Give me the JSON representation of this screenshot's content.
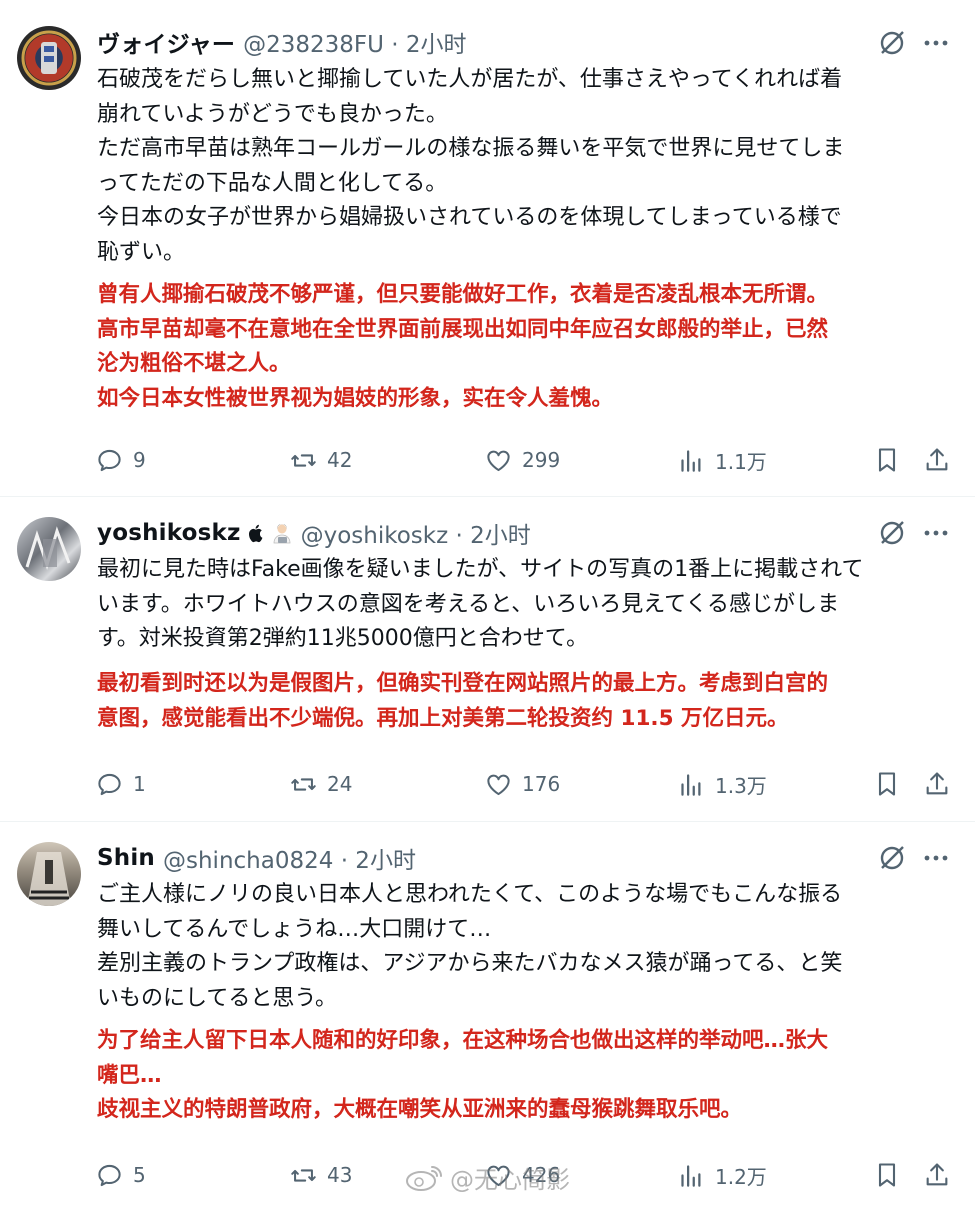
{
  "posts": [
    {
      "name": "ヴォイジャー",
      "handle": "@238238FU · 2小时",
      "ja": [
        "石破茂をだらし無いと揶揄していた人が居たが、仕事さえやってくれれば着\n崩れていようがどうでも良かった。",
        "ただ高市早苗は熟年コールガールの様な振る舞いを平気で世界に見せてしま\nってただの下品な人間と化してる。",
        "今日本の女子が世界から娼婦扱いされているのを体現してしまっている様で\n恥ずい。"
      ],
      "cn": [
        "曾有人揶揄石破茂不够严谨，但只要能做好工作，衣着是否凌乱根本无所谓。",
        "高市早苗却毫不在意地在全世界面前展现出如同中年应召女郎般的举止，已然\n沦为粗俗不堪之人。",
        "如今日本女性被世界视为娼妓的形象，实在令人羞愧。"
      ],
      "replies": "9",
      "reposts": "42",
      "likes": "299",
      "views": "1.1万"
    },
    {
      "name": "yoshikoskz",
      "handle": "@yoshikoskz · 2小时",
      "ja": [
        "最初に見た時はFake画像を疑いましたが、サイトの写真の1番上に掲載されて\nいます。ホワイトハウスの意図を考えると、いろいろ見えてくる感じがしま\nす。対米投資第2弾約11兆5000億円と合わせて。"
      ],
      "cn": [
        "最初看到时还以为是假图片，但确实刊登在网站照片的最上方。考虑到白宫的\n意图，感觉能看出不少端倪。再加上对美第二轮投资约 11.5 万亿日元。"
      ],
      "replies": "1",
      "reposts": "24",
      "likes": "176",
      "views": "1.3万"
    },
    {
      "name": "Shin",
      "handle": "@shincha0824 · 2小时",
      "ja": [
        "ご主人様にノリの良い日本人と思われたくて、このような場でもこんな振る\n舞いしてるんでしょうね…大口開けて…",
        "差別主義のトランプ政権は、アジアから来たバカなメス猿が踊ってる、と笑\nいものにしてると思う。"
      ],
      "cn": [
        "为了给主人留下日本人随和的好印象，在这种场合也做出这样的举动吧…张大\n嘴巴…",
        "歧视主义的特朗普政府，大概在嘲笑从亚洲来的蠢母猴跳舞取乐吧。"
      ],
      "replies": "5",
      "reposts": "43",
      "likes": "426",
      "views": "1.2万"
    }
  ],
  "watermark": "@无心简影",
  "colors": {
    "translation": "#d3261c",
    "muted": "#536471",
    "text": "#0f1419"
  }
}
